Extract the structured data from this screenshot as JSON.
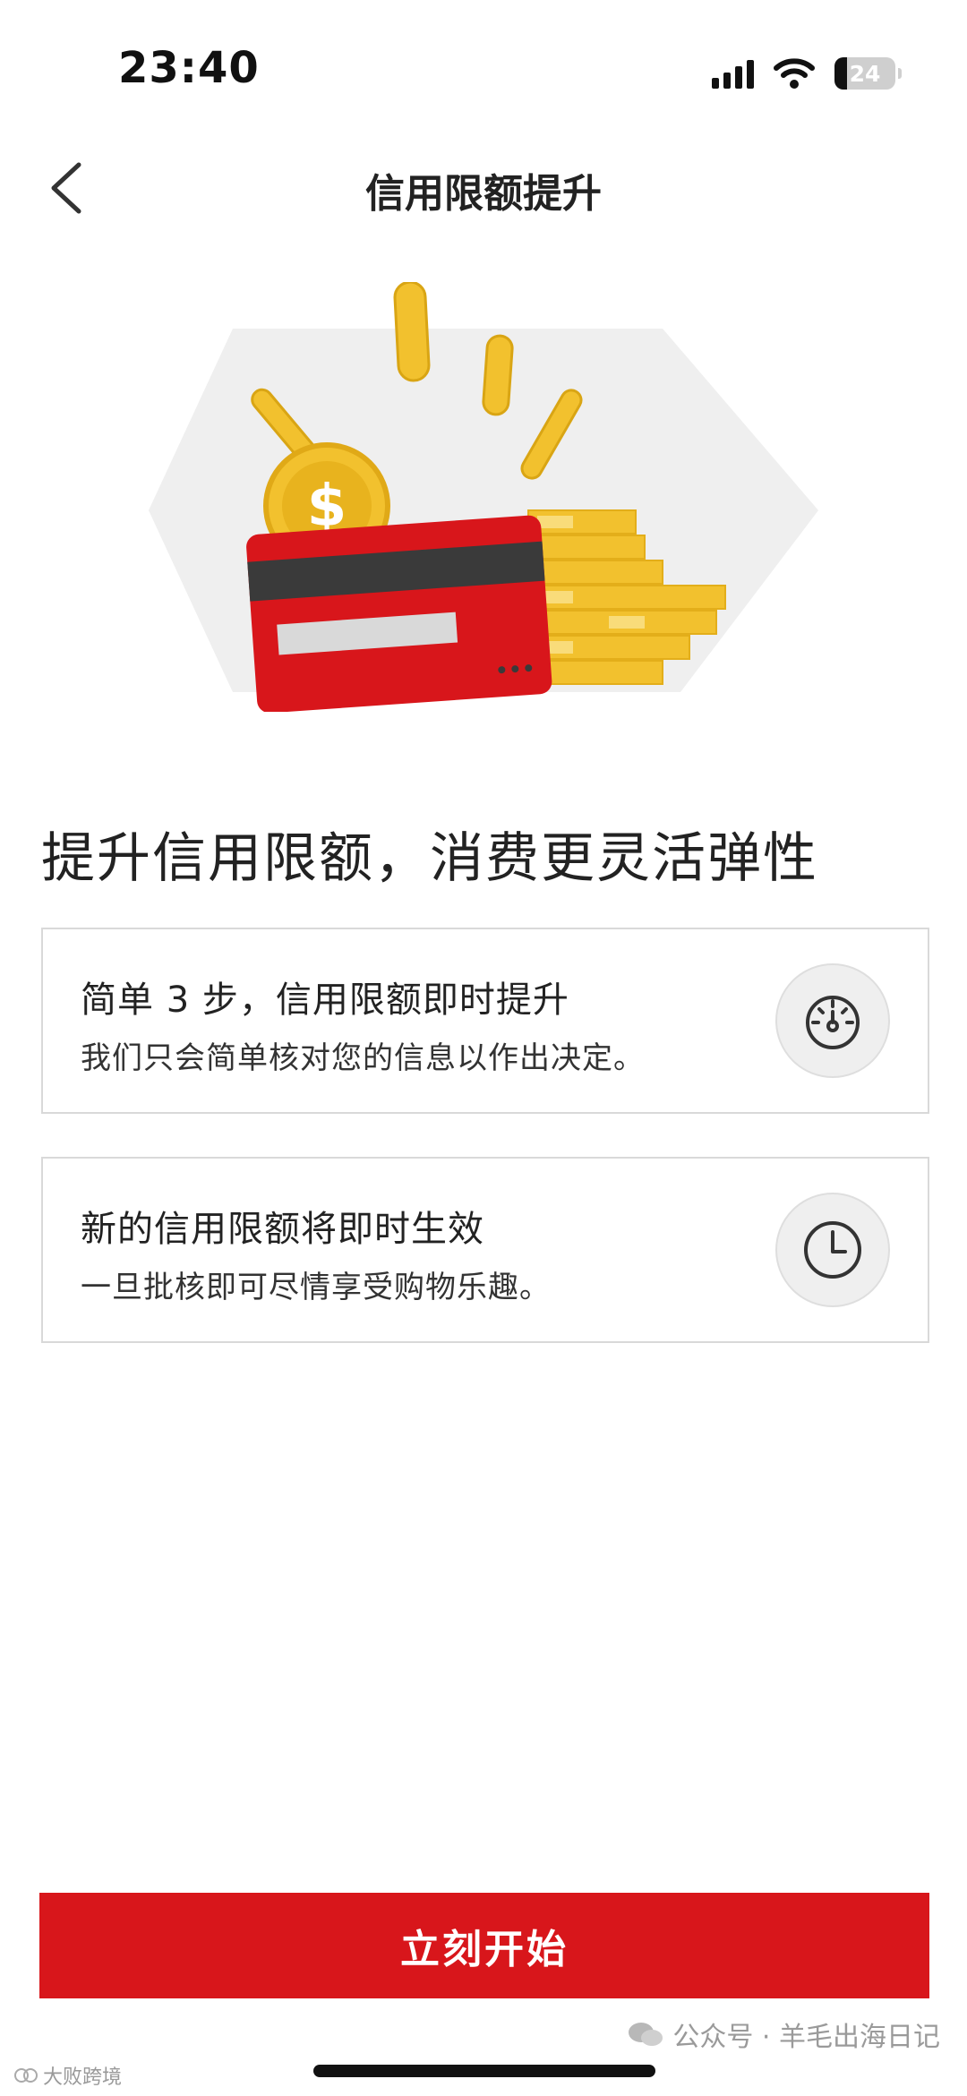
{
  "status_bar": {
    "time": "23:40",
    "battery_level": "24",
    "icons": [
      "signal-icon",
      "wifi-icon",
      "battery-icon"
    ]
  },
  "nav": {
    "title": "信用限额提升",
    "back_icon": "chevron-left-icon"
  },
  "hero": {
    "illustration": "credit-card-coins-illustration",
    "colors": {
      "card": "#d8161b",
      "coin": "#f2c12e",
      "background": "#efefef"
    }
  },
  "headline": "提升信用限额，消费更灵活弹性",
  "features": [
    {
      "title": "简单 3 步，信用限额即时提升",
      "desc": "我们只会简单核对您的信息以作出决定。",
      "icon": "speedometer-icon"
    },
    {
      "title": "新的信用限额将即时生效",
      "desc": "一旦批核即可尽情享受购物乐趣。",
      "icon": "clock-icon"
    }
  ],
  "cta": {
    "label": "立刻开始",
    "color": "#d8161b"
  },
  "watermarks": {
    "left": "大败跨境",
    "right": "公众号 · 羊毛出海日记"
  }
}
